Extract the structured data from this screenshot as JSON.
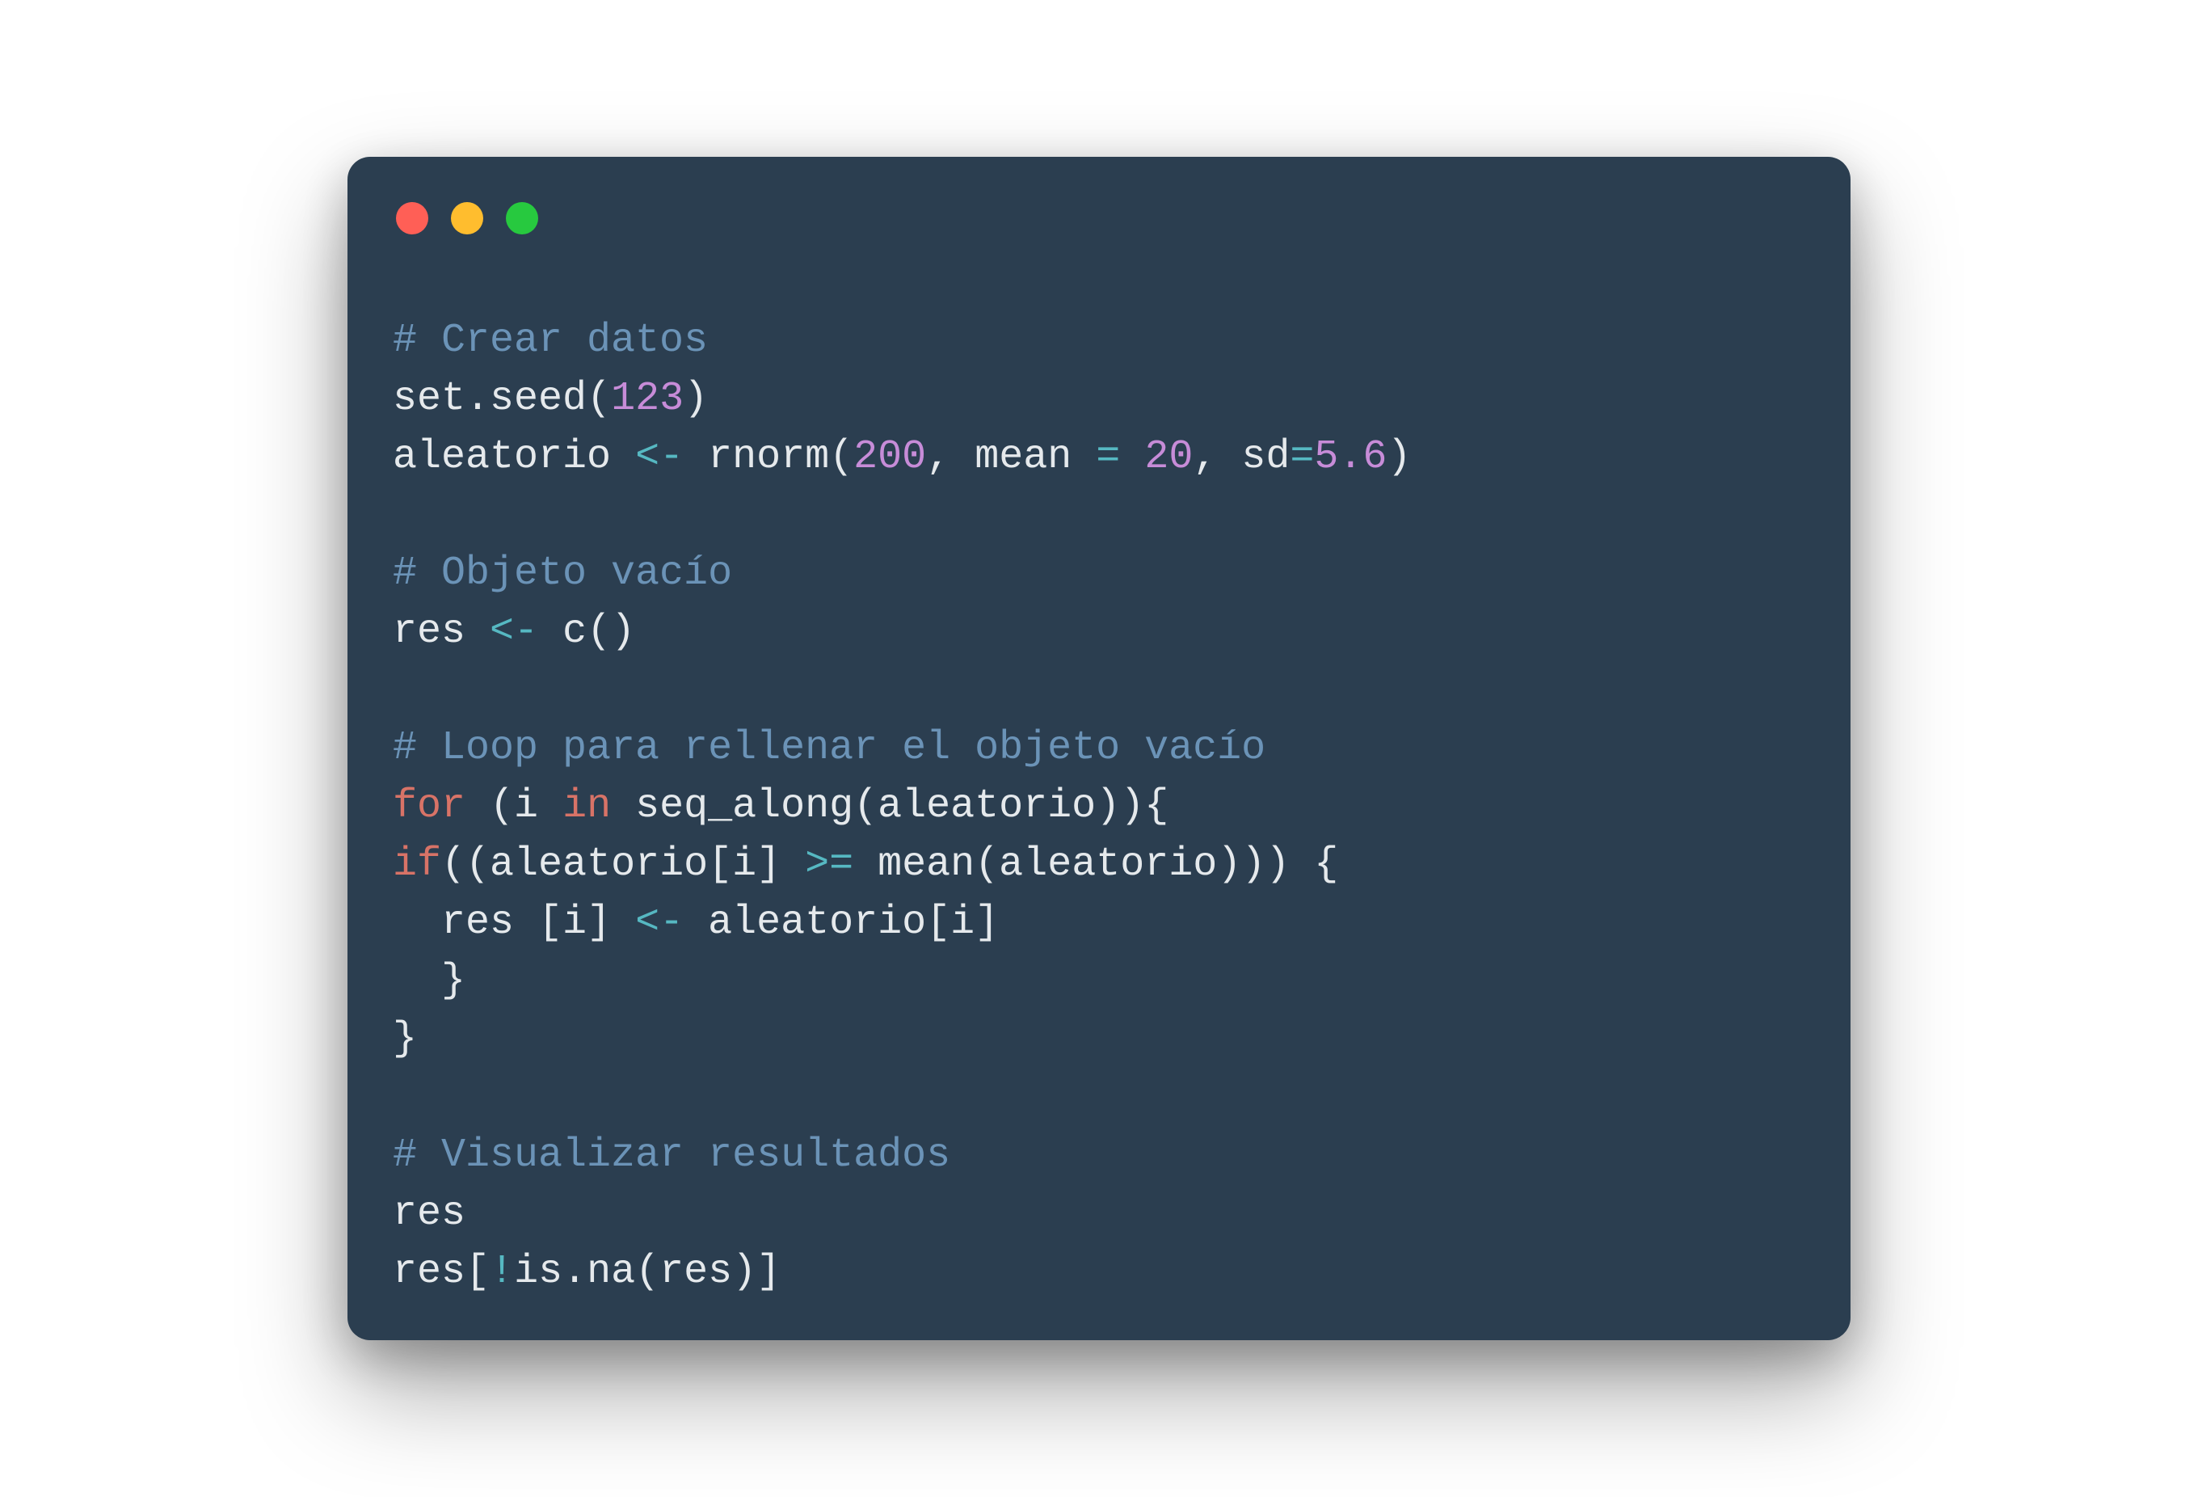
{
  "window": {
    "traffic_lights": [
      "red",
      "yellow",
      "green"
    ]
  },
  "code": {
    "c1": "# Crear datos",
    "l2_a": "set.seed(",
    "l2_n": "123",
    "l2_b": ")",
    "l3_a": "aleatorio ",
    "l3_op1": "<-",
    "l3_b": " rnorm(",
    "l3_n1": "200",
    "l3_c": ", mean ",
    "l3_op2": "=",
    "l3_d": " ",
    "l3_n2": "20",
    "l3_e": ", sd",
    "l3_op3": "=",
    "l3_n3": "5.6",
    "l3_f": ")",
    "c2": "# Objeto vacío",
    "l5_a": "res ",
    "l5_op": "<-",
    "l5_b": " c()",
    "c3": "# Loop para rellenar el objeto vacío",
    "l7_kw1": "for",
    "l7_a": " (i ",
    "l7_kw2": "in",
    "l7_b": " seq_along(aleatorio)){",
    "l8_kw": "if",
    "l8_a": "((aleatorio[i] ",
    "l8_op": ">=",
    "l8_b": " mean(aleatorio))) {",
    "l9_a": "  res [i] ",
    "l9_op": "<-",
    "l9_b": " aleatorio[i]",
    "l10": "  }",
    "l11": "}",
    "c4": "# Visualizar resultados",
    "l13": "res",
    "l14_a": "res[",
    "l14_op": "!",
    "l14_b": "is.na(res)]"
  }
}
